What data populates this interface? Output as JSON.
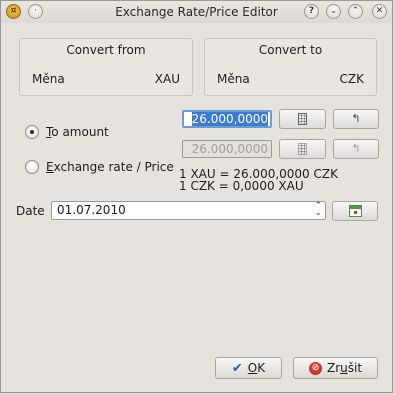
{
  "window": {
    "title": "Exchange Rate/Price Editor",
    "help_label": "?",
    "minimize_label": "⌄",
    "maximize_label": "⌃",
    "close_label": "✕",
    "menu_label": "·"
  },
  "convert_from": {
    "title": "Convert from",
    "label": "Měna",
    "value": "XAU"
  },
  "convert_to": {
    "title": "Convert to",
    "label": "Měna",
    "value": "CZK"
  },
  "options": {
    "to_amount_accel": "T",
    "to_amount_rest": "o amount",
    "exchange_rate_accel": "E",
    "exchange_rate_rest": "xchange rate / Price",
    "selected": "to_amount"
  },
  "amount": {
    "to_amount_value": "26.000,0000",
    "exchange_rate_value": "26.000,0000"
  },
  "rate": {
    "line1": "1 XAU = 26.000,0000 CZK",
    "line2": "1 CZK = 0,0000 XAU"
  },
  "date": {
    "label": "Date",
    "value": "01.07.2010"
  },
  "buttons": {
    "ok_accel": "O",
    "ok_rest": "K",
    "cancel_prefix": "Zr",
    "cancel_accel": "u",
    "cancel_rest": "šit"
  },
  "icons": {
    "app": "exchange-app-icon",
    "calculator": "calculator-icon",
    "reverse": "reverse-arrow-icon",
    "calendar": "calendar-icon",
    "ok": "checkmark-icon",
    "cancel": "stop-icon"
  }
}
